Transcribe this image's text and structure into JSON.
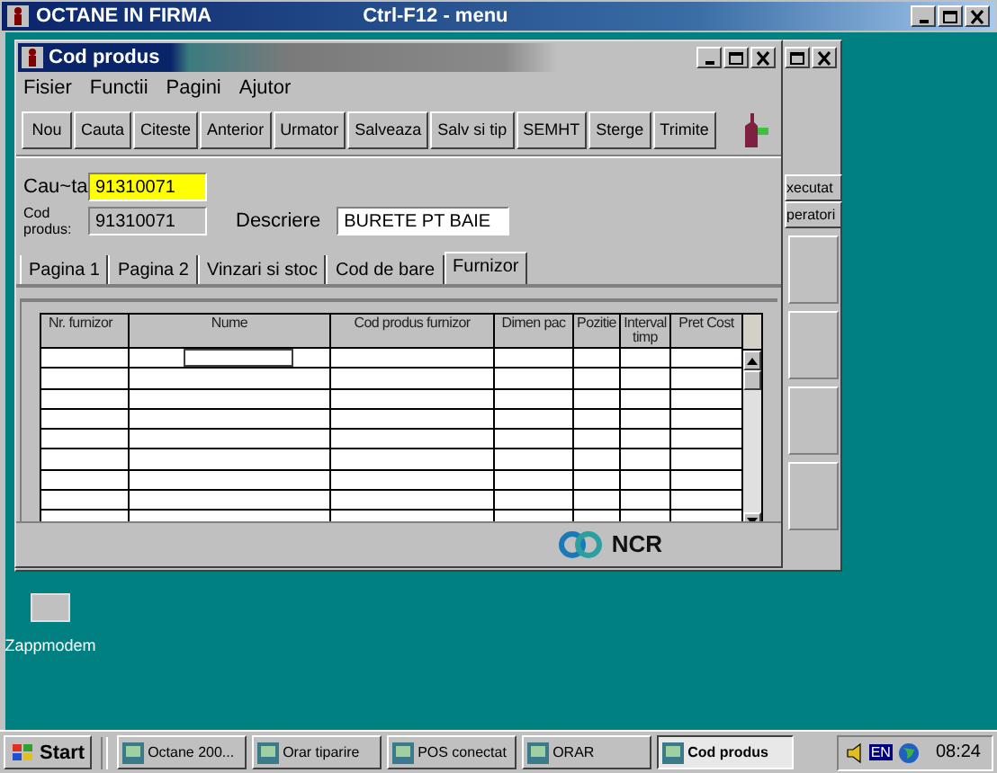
{
  "main_window": {
    "title": "OCTANE IN FIRMA",
    "hint": "Ctrl-F12 - menu"
  },
  "back_window": {
    "buttons": [
      "xecutat",
      "peratori"
    ]
  },
  "window": {
    "title": "Cod produs",
    "menu": [
      "Fisier",
      "Functii",
      "Pagini",
      "Ajutor"
    ],
    "toolbar": [
      "Nou",
      "Cauta",
      "Citeste",
      "Anterior",
      "Urmator",
      "Salveaza",
      "Salv si tip",
      "SEMHT",
      "Sterge",
      "Trimite"
    ],
    "search": {
      "label": "Cau~ta",
      "value": "91310071"
    },
    "code": {
      "label": "Cod produs:",
      "value": "91310071"
    },
    "description": {
      "label": "Descriere",
      "value": "BURETE PT BAIE"
    },
    "tabs": [
      {
        "label": "Pagina 1",
        "selected": false
      },
      {
        "label": "Pagina 2",
        "selected": false
      },
      {
        "label": "Vinzari si stoc",
        "selected": false
      },
      {
        "label": "Cod de bare",
        "selected": false
      },
      {
        "label": "Furnizor",
        "selected": true
      }
    ],
    "table": {
      "columns": [
        "Nr. furnizor",
        "Nume",
        "Cod produs furnizor",
        "Dimen pac",
        "Pozitie",
        "Interval timp",
        "Pret Cost"
      ]
    },
    "footer": {
      "logo": "NCR"
    }
  },
  "desktop_icons": [
    {
      "label": "Zappmodem"
    }
  ],
  "taskbar": {
    "start": "Start",
    "tasks": [
      {
        "label": "Octane 200...",
        "selected": false
      },
      {
        "label": "Orar tiparire",
        "selected": false
      },
      {
        "label": "POS conectat",
        "selected": false
      },
      {
        "label": "ORAR",
        "selected": false
      },
      {
        "label": "Cod produs",
        "selected": true
      }
    ],
    "tray": {
      "language": "EN",
      "clock": "08:24"
    }
  }
}
